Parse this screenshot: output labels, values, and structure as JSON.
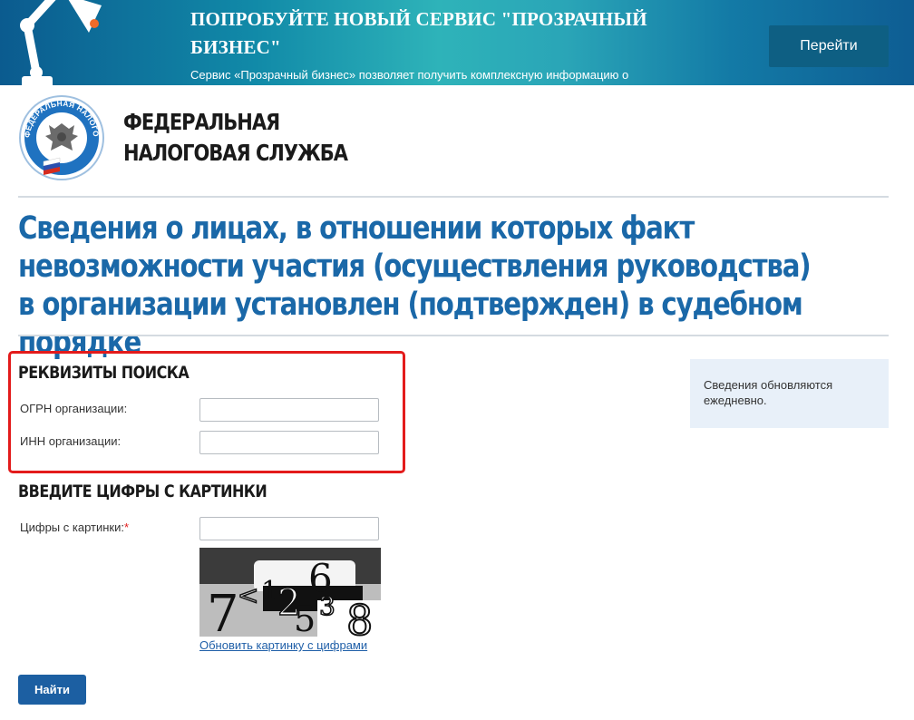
{
  "banner": {
    "title": "ПОПРОБУЙТЕ НОВЫЙ СЕРВИС \"ПРОЗРАЧНЫЙ БИЗНЕС\"",
    "text": "Сервис «Прозрачный бизнес» позволяет получить комплексную информацию о налогоплательщике – организации.",
    "button_label": "Перейти"
  },
  "header": {
    "org_line1": "ФЕДЕРАЛЬНАЯ",
    "org_line2": "НАЛОГОВАЯ СЛУЖБА",
    "logo_text": "ФЕДЕРАЛЬНАЯ НАЛОГОВАЯ СЛУЖБА"
  },
  "page": {
    "title": "Сведения о лицах, в отношении которых факт невозможности участия (осуществления руководства) в организации установлен (подтвержден) в судебном порядке"
  },
  "search": {
    "heading": "РЕКВИЗИТЫ ПОИСКА",
    "ogrn_label": "ОГРН организации:",
    "ogrn_value": "",
    "inn_label": "ИНН организации:",
    "inn_value": ""
  },
  "captcha": {
    "heading": "ВВЕДИТЕ ЦИФРЫ С КАРТИНКИ",
    "label": "Цифры с картинки:",
    "required_mark": "*",
    "value": "",
    "image_text": "7<1 2 6 5 3 8",
    "refresh_link": "Обновить картинку с цифрами"
  },
  "info": {
    "text": "Сведения обновляются ежедневно."
  },
  "actions": {
    "find_label": "Найти"
  },
  "colors": {
    "title_blue": "#1a68a8",
    "button_blue": "#1c5fa2",
    "highlight_red": "#e31b1b",
    "info_bg": "#e8f0f9"
  }
}
